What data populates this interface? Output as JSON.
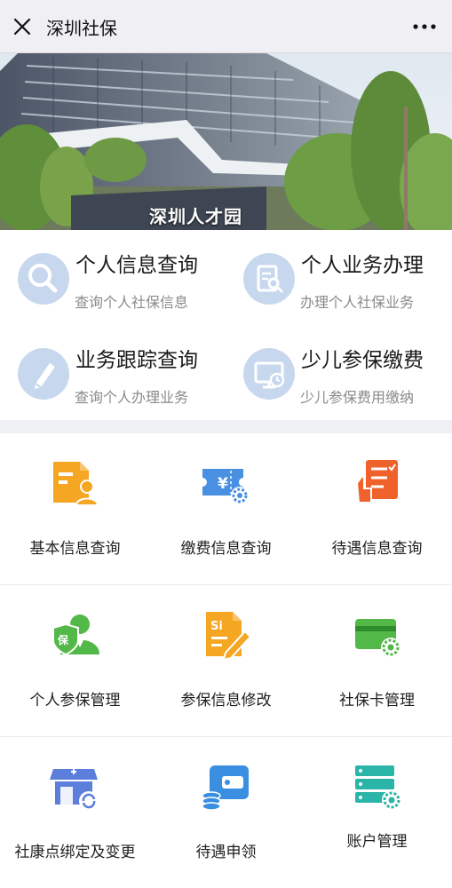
{
  "header": {
    "title": "深圳社保"
  },
  "banner": {
    "sign_text": "深圳人才园"
  },
  "quick_services": [
    {
      "title": "个人信息查询",
      "subtitle": "查询个人社保信息",
      "icon": "search-icon"
    },
    {
      "title": "个人业务办理",
      "subtitle": "办理个人社保业务",
      "icon": "document-search-icon"
    },
    {
      "title": "业务跟踪查询",
      "subtitle": "查询个人办理业务",
      "icon": "pencil-icon"
    },
    {
      "title": "少儿参保缴费",
      "subtitle": "少儿参保费用缴纳",
      "icon": "monitor-clock-icon"
    }
  ],
  "grid": [
    {
      "label": "基本信息查询",
      "icon": "id-card-icon",
      "color": "#f5a623"
    },
    {
      "label": "缴费信息查询",
      "icon": "ticket-yen-gear-icon",
      "color": "#4a90e2"
    },
    {
      "label": "待遇信息查询",
      "icon": "checklist-hand-icon",
      "color": "#f0622b"
    },
    {
      "label": "个人参保管理",
      "icon": "insured-person-icon",
      "color": "#52b848"
    },
    {
      "label": "参保信息修改",
      "icon": "si-document-edit-icon",
      "color": "#f5a623"
    },
    {
      "label": "社保卡管理",
      "icon": "card-gear-icon",
      "color": "#52b848"
    },
    {
      "label": "社康点绑定及变更",
      "icon": "clinic-refresh-icon",
      "color": "#5b7fdb"
    },
    {
      "label": "待遇申领",
      "icon": "wallet-coins-icon",
      "color": "#3a8fe0"
    },
    {
      "label": "账户管理",
      "icon": "server-gear-icon",
      "color": "#2bb5a8"
    }
  ]
}
